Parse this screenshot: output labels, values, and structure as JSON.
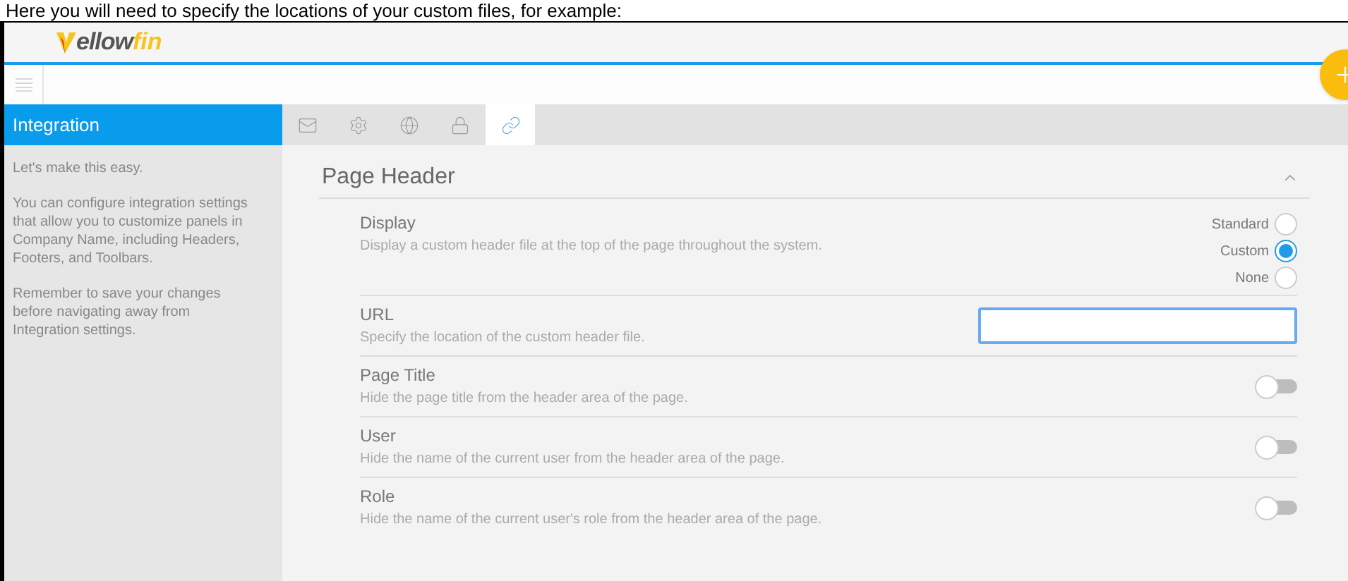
{
  "caption": "Here you will need to specify the locations of your custom files, for example:",
  "logo": {
    "main": "ellow",
    "accent": "fin"
  },
  "sidebar": {
    "title": "Integration",
    "paragraphs": [
      "Let's make this easy.",
      "You can configure integration settings that allow you to customize panels in Company Name, including Headers, Footers, and Toolbars.",
      "Remember to save your changes before navigating away from Integration settings."
    ]
  },
  "tabs": [
    {
      "selected": false
    },
    {
      "selected": false
    },
    {
      "selected": false
    },
    {
      "selected": false
    },
    {
      "selected": true
    }
  ],
  "section": {
    "title": "Page Header",
    "expanded": true
  },
  "settings": [
    {
      "kind": "radio",
      "label": "Display",
      "description": "Display a custom header file at the top of the page throughout the system.",
      "options": [
        {
          "label": "Standard",
          "selected": false
        },
        {
          "label": "Custom",
          "selected": true
        },
        {
          "label": "None",
          "selected": false
        }
      ]
    },
    {
      "kind": "text",
      "label": "URL",
      "description": "Specify the location of the custom header file."
    },
    {
      "kind": "toggle",
      "label": "Page Title",
      "description": "Hide the page title from the header area of the page.",
      "on": false
    },
    {
      "kind": "toggle",
      "label": "User",
      "description": "Hide the name of the current user from the header area of the page.",
      "on": false
    },
    {
      "kind": "toggle",
      "label": "Role",
      "description": "Hide the name of the current user's role from the header area of the page.",
      "on": false
    }
  ]
}
